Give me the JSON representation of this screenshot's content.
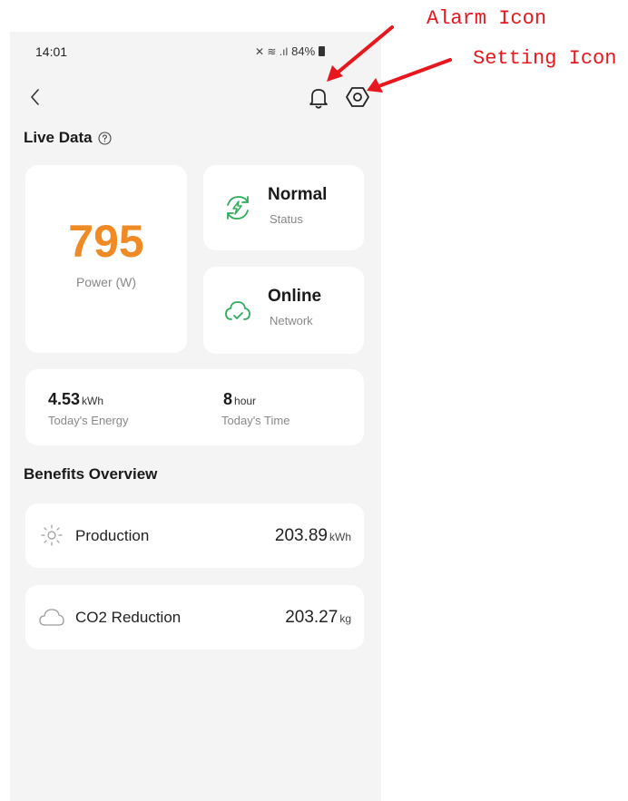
{
  "status_bar": {
    "time": "14:01",
    "signal_glyphs": "✕ ≋ .ıl",
    "battery": "84%"
  },
  "header": {
    "back_icon": "chevron-left-icon",
    "alarm_icon": "bell-icon",
    "settings_icon": "gear-icon"
  },
  "live_data": {
    "title": "Live Data",
    "help_icon": "question-circle-icon",
    "power": {
      "value": "795",
      "label": "Power (W)"
    },
    "status": {
      "title": "Normal",
      "label": "Status"
    },
    "network": {
      "title": "Online",
      "label": "Network"
    },
    "energy": {
      "value": "4.53",
      "unit": "kWh",
      "label": "Today's Energy"
    },
    "time": {
      "value": "8",
      "unit": "hour",
      "label": "Today's Time"
    }
  },
  "benefits": {
    "title": "Benefits Overview",
    "production": {
      "label": "Production",
      "value": "203.89",
      "unit": "kWh",
      "icon": "sun-icon"
    },
    "co2": {
      "label": "CO2 Reduction",
      "value": "203.27",
      "unit": "kg",
      "icon": "cloud-icon"
    }
  },
  "annotations": {
    "alarm": "Alarm Icon",
    "setting": "Setting Icon"
  },
  "colors": {
    "power_accent": "#f08a24",
    "status_green": "#2eae5a",
    "annotation_red": "#e8161d",
    "background": "#f4f4f4",
    "card": "#ffffff"
  }
}
